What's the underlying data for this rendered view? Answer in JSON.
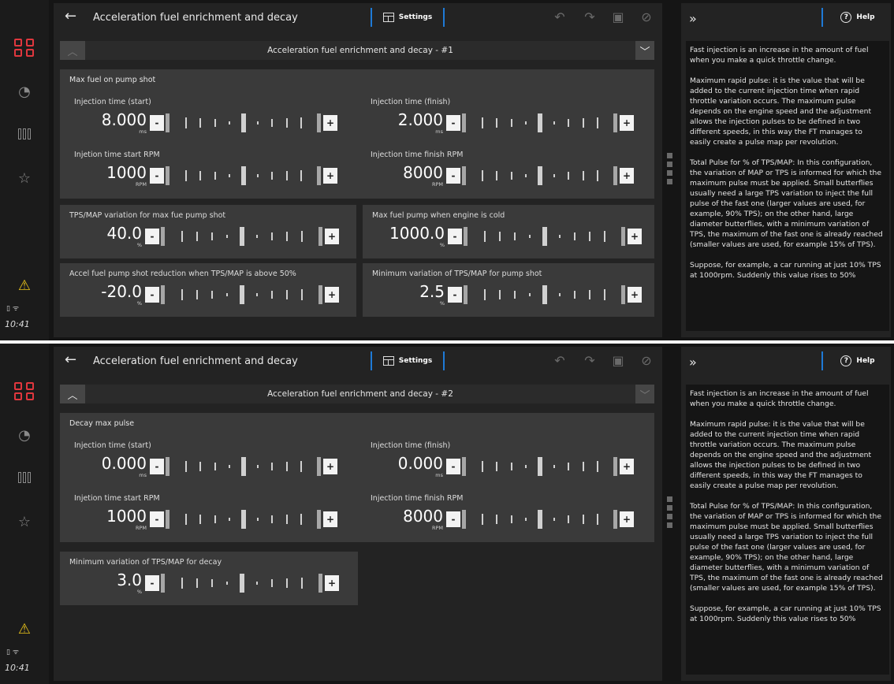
{
  "nav": {
    "time": "10:41",
    "status_icons": "▯ ᯤ"
  },
  "settings_label": "Settings",
  "help_label": "Help",
  "page_title": "Acceleration fuel enrichment and decay",
  "screens": [
    {
      "header_title": "Acceleration fuel enrichment and decay - #1",
      "groups": {
        "g1_title": "Max fuel on pump shot",
        "inj_start": {
          "label": "Injection time (start)",
          "value": "8.000",
          "unit": "ms"
        },
        "inj_finish": {
          "label": "Injection time (finish)",
          "value": "2.000",
          "unit": "ms"
        },
        "rpm_start": {
          "label": "Injetion time start RPM",
          "value": "1000",
          "unit": "RPM"
        },
        "rpm_finish": {
          "label": "Injection time finish RPM",
          "value": "8000",
          "unit": "RPM"
        },
        "tps_var": {
          "label": "TPS/MAP variation for max fue pump shot",
          "value": "40.0",
          "unit": "%"
        },
        "cold": {
          "label": "Max fuel pump when engine is cold",
          "value": "1000.0",
          "unit": "%"
        },
        "accel_red": {
          "label": "Accel fuel pump shot reduction when TPS/MAP is above 50%",
          "value": "-20.0",
          "unit": "%"
        },
        "min_var": {
          "label": "Minimum variation of TPS/MAP for pump shot",
          "value": "2.5",
          "unit": "%"
        }
      }
    },
    {
      "header_title": "Acceleration fuel enrichment and decay - #2",
      "groups": {
        "g1_title": "Decay max pulse",
        "inj_start": {
          "label": "Injection time (start)",
          "value": "0.000",
          "unit": "ms"
        },
        "inj_finish": {
          "label": "Injection time (finish)",
          "value": "0.000",
          "unit": "ms"
        },
        "rpm_start": {
          "label": "Injetion time start RPM",
          "value": "1000",
          "unit": "RPM"
        },
        "rpm_finish": {
          "label": "Injection time finish RPM",
          "value": "8000",
          "unit": "RPM"
        },
        "min_var_decay": {
          "label": "Minimum variation of TPS/MAP for decay",
          "value": "3.0",
          "unit": "%"
        }
      }
    }
  ],
  "help_text": {
    "p1": "Fast injection is an increase in the amount of fuel when you make a quick throttle change.",
    "p2": "Maximum rapid pulse: it is the value that will be added to the current injection time when rapid throttle variation occurs. The maximum pulse depends on the engine speed and the adjustment allows the injection pulses to be defined in two different speeds, in this way the FT manages to easily create a pulse map per revolution.",
    "p3": "Total Pulse for % of TPS/MAP: In this configuration, the variation of MAP or TPS is informed for which the maximum pulse must be applied. Small butterflies usually need a large TPS variation to inject the full pulse of the fast one (larger values are used, for example, 90% TPS); on the other hand, large diameter butterflies, with a minimum variation of TPS, the maximum of the fast one is already reached (smaller values are used, for example 15% of TPS).",
    "p4": "Suppose, for example, a car running at just 10% TPS at 1000rpm. Suddenly this value rises to 50%"
  },
  "icons": {
    "logo": "logo-grid-icon",
    "gauge": "gauge-icon",
    "bars": "bars-icon",
    "star": "star-icon",
    "warning": "warning-icon",
    "back": "back-arrow-icon",
    "undo": "undo-icon",
    "redo": "redo-icon",
    "save": "save-icon",
    "cancel": "cancel-icon",
    "collapse": "double-chevron-icon"
  },
  "colors": {
    "accent": "#e0373e",
    "blue": "#1e7ad6",
    "warning": "#e8c21a"
  },
  "glyphs": {
    "minus": "-",
    "plus": "+",
    "back": "←",
    "undo": "↶",
    "redo": "↷",
    "save": "▣",
    "cancel": "⊘",
    "collapse": "»",
    "chev_up": "︿",
    "chev_down": "﹀",
    "gauge": "◔",
    "star": "☆",
    "warn": "⚠",
    "q": "?"
  }
}
